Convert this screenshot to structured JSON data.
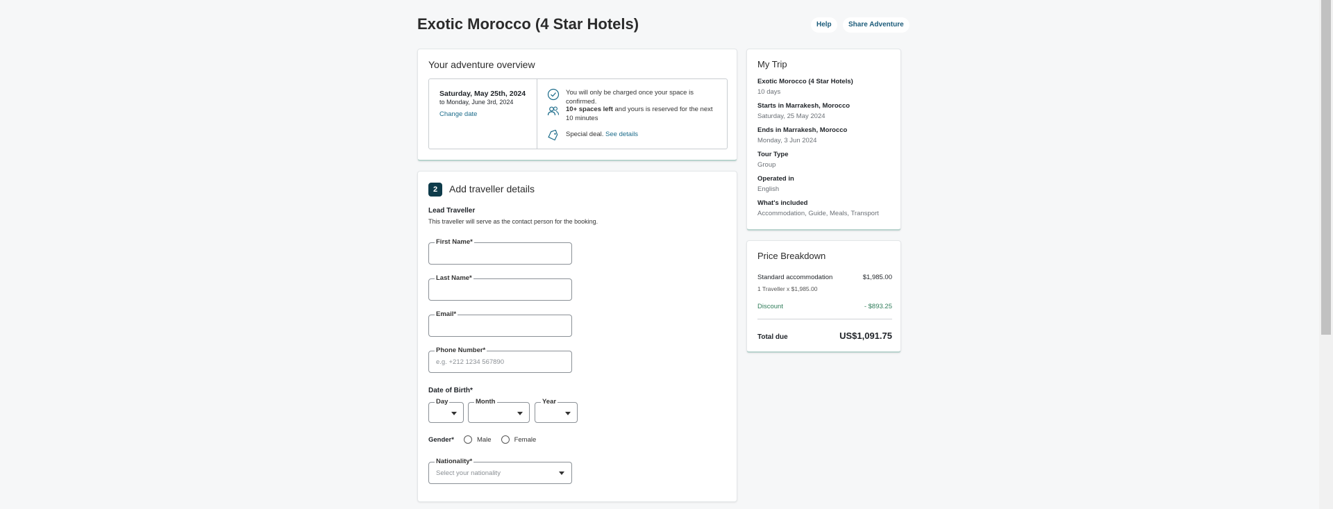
{
  "header": {
    "title": "Exotic Morocco (4 Star Hotels)",
    "help_label": "Help",
    "share_label": "Share Adventure"
  },
  "overview": {
    "title": "Your adventure overview",
    "date_start": "Saturday, May 25th, 2024",
    "date_end": "to Monday, June 3rd, 2024",
    "change_date": "Change date",
    "charged_note": "You will only be charged once your space is confirmed.",
    "spaces_bold": "10+ spaces left",
    "spaces_rest": " and yours is reserved for the next 10 minutes",
    "deal_text": "Special deal.",
    "deal_link": "See details"
  },
  "traveller": {
    "step_number": "2",
    "title": "Add traveller details",
    "lead_title": "Lead Traveller",
    "lead_sub": "This traveller will serve as the contact person for the booking.",
    "first_name_label": "First Name*",
    "last_name_label": "Last Name*",
    "email_label": "Email*",
    "phone_label": "Phone Number*",
    "phone_placeholder": "e.g. +212 1234 567890",
    "dob_label": "Date of Birth*",
    "day_label": "Day",
    "month_label": "Month",
    "year_label": "Year",
    "gender_label": "Gender*",
    "male_label": "Male",
    "female_label": "Female",
    "nationality_label": "Nationality*",
    "nationality_placeholder": "Select your nationality"
  },
  "my_trip": {
    "title": "My Trip",
    "items": [
      {
        "key": "Exotic Morocco (4 Star Hotels)",
        "value": "10 days"
      },
      {
        "key": "Starts in Marrakesh, Morocco",
        "value": "Saturday, 25 May 2024"
      },
      {
        "key": "Ends in Marrakesh, Morocco",
        "value": "Monday, 3 Jun 2024"
      },
      {
        "key": "Tour Type",
        "value": "Group"
      },
      {
        "key": "Operated in",
        "value": "English"
      },
      {
        "key": "What's included",
        "value": "Accommodation, Guide, Meals, Transport"
      }
    ]
  },
  "price": {
    "title": "Price Breakdown",
    "accommodation_label": "Standard accommodation",
    "accommodation_value": "$1,985.00",
    "accommodation_sub": "1 Traveller x $1,985.00",
    "discount_label": "Discount",
    "discount_value": "- $893.25",
    "total_label": "Total due",
    "total_value": "US$1,091.75"
  },
  "colors": {
    "accent": "#1b6b8a",
    "badge": "#0e3b4a",
    "discount": "#2f7d5a"
  }
}
